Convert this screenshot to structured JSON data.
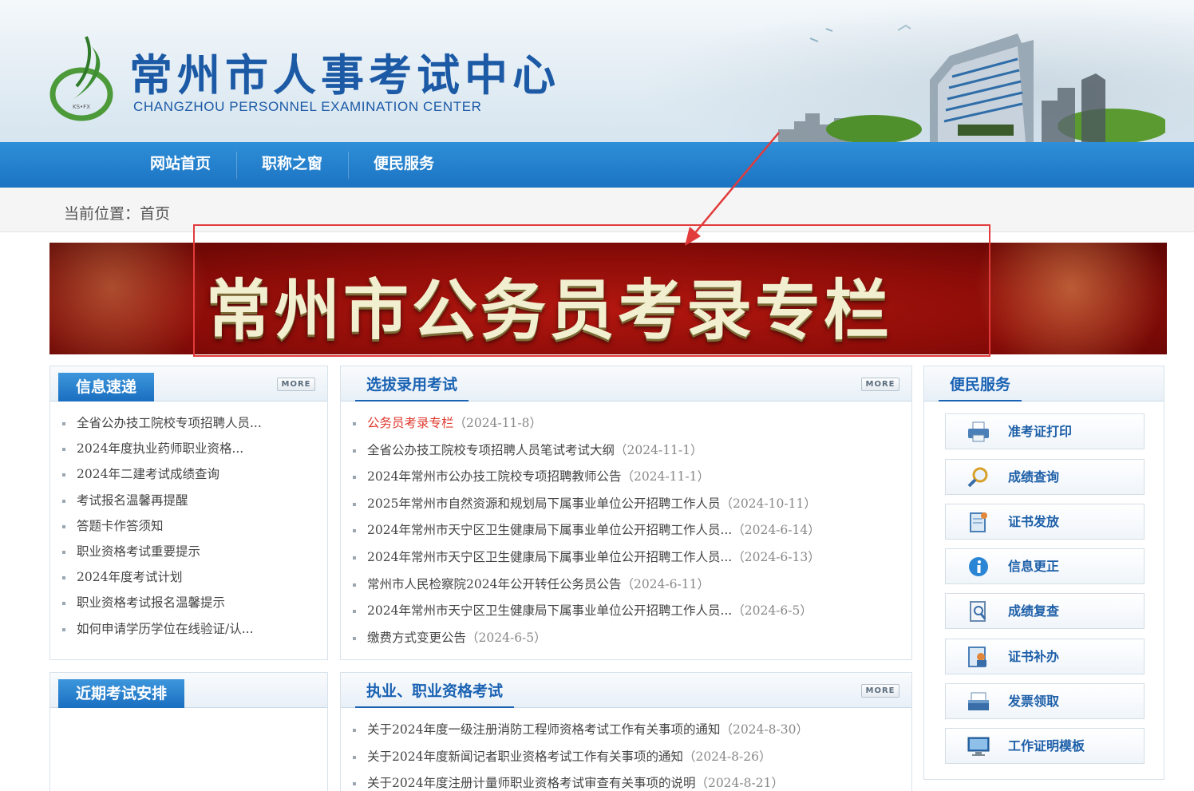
{
  "header": {
    "logo_cn": "常州市人事考试中心",
    "logo_en": "CHANGZHOU PERSONNEL EXAMINATION CENTER",
    "logo_badge": "KS•FX",
    "brand_color": "#1c5aa6"
  },
  "nav": {
    "items": [
      {
        "label": "网站首页"
      },
      {
        "label": "职称之窗"
      },
      {
        "label": "便民服务"
      }
    ]
  },
  "breadcrumb": {
    "text": "当前位置：首页"
  },
  "banner": {
    "title": "常州市公务员考录专栏",
    "annotation_color": "#e23b3b"
  },
  "info_panel": {
    "title": "信息速递",
    "more": "MORE",
    "items": [
      "全省公办技工院校专项招聘人员...",
      "2024年度执业药师职业资格...",
      "2024年二建考试成绩查询",
      "考试报名温馨再提醒",
      "答题卡作答须知",
      "职业资格考试重要提示",
      "2024年度考试计划",
      "职业资格考试报名温馨提示",
      "如何申请学历学位在线验证/认..."
    ]
  },
  "recent_panel": {
    "title": "近期考试安排"
  },
  "selection_panel": {
    "title": "选拔录用考试",
    "more": "MORE",
    "items": [
      {
        "title": "公务员考录专栏",
        "date": "（2024-11-8）",
        "highlight": true
      },
      {
        "title": "全省公办技工院校专项招聘人员笔试考试大纲",
        "date": "（2024-11-1）"
      },
      {
        "title": "2024年常州市公办技工院校专项招聘教师公告",
        "date": "（2024-11-1）"
      },
      {
        "title": "2025年常州市自然资源和规划局下属事业单位公开招聘工作人员",
        "date": "（2024-10-11）"
      },
      {
        "title": "2024年常州市天宁区卫生健康局下属事业单位公开招聘工作人员...",
        "date": "（2024-6-14）"
      },
      {
        "title": "2024年常州市天宁区卫生健康局下属事业单位公开招聘工作人员...",
        "date": "（2024-6-13）"
      },
      {
        "title": "常州市人民检察院2024年公开转任公务员公告",
        "date": "（2024-6-11）"
      },
      {
        "title": "2024年常州市天宁区卫生健康局下属事业单位公开招聘工作人员...",
        "date": "（2024-6-5）"
      },
      {
        "title": "缴费方式变更公告",
        "date": "（2024-6-5）"
      }
    ]
  },
  "qualification_panel": {
    "title": "执业、职业资格考试",
    "more": "MORE",
    "items": [
      {
        "title": "关于2024年度一级注册消防工程师资格考试工作有关事项的通知",
        "date": "（2024-8-30）"
      },
      {
        "title": "关于2024年度新闻记者职业资格考试工作有关事项的通知",
        "date": "（2024-8-26）"
      },
      {
        "title": "关于2024年度注册计量师职业资格考试审查有关事项的说明",
        "date": "（2024-8-21）"
      }
    ]
  },
  "service_panel": {
    "title": "便民服务",
    "items": [
      {
        "label": "准考证打印",
        "icon": "printer-icon"
      },
      {
        "label": "成绩查询",
        "icon": "magnifier-icon"
      },
      {
        "label": "证书发放",
        "icon": "certificate-icon"
      },
      {
        "label": "信息更正",
        "icon": "info-icon"
      },
      {
        "label": "成绩复查",
        "icon": "document-search-icon"
      },
      {
        "label": "证书补办",
        "icon": "id-card-icon"
      },
      {
        "label": "发票领取",
        "icon": "invoice-box-icon"
      },
      {
        "label": "工作证明模板",
        "icon": "monitor-icon"
      }
    ]
  }
}
